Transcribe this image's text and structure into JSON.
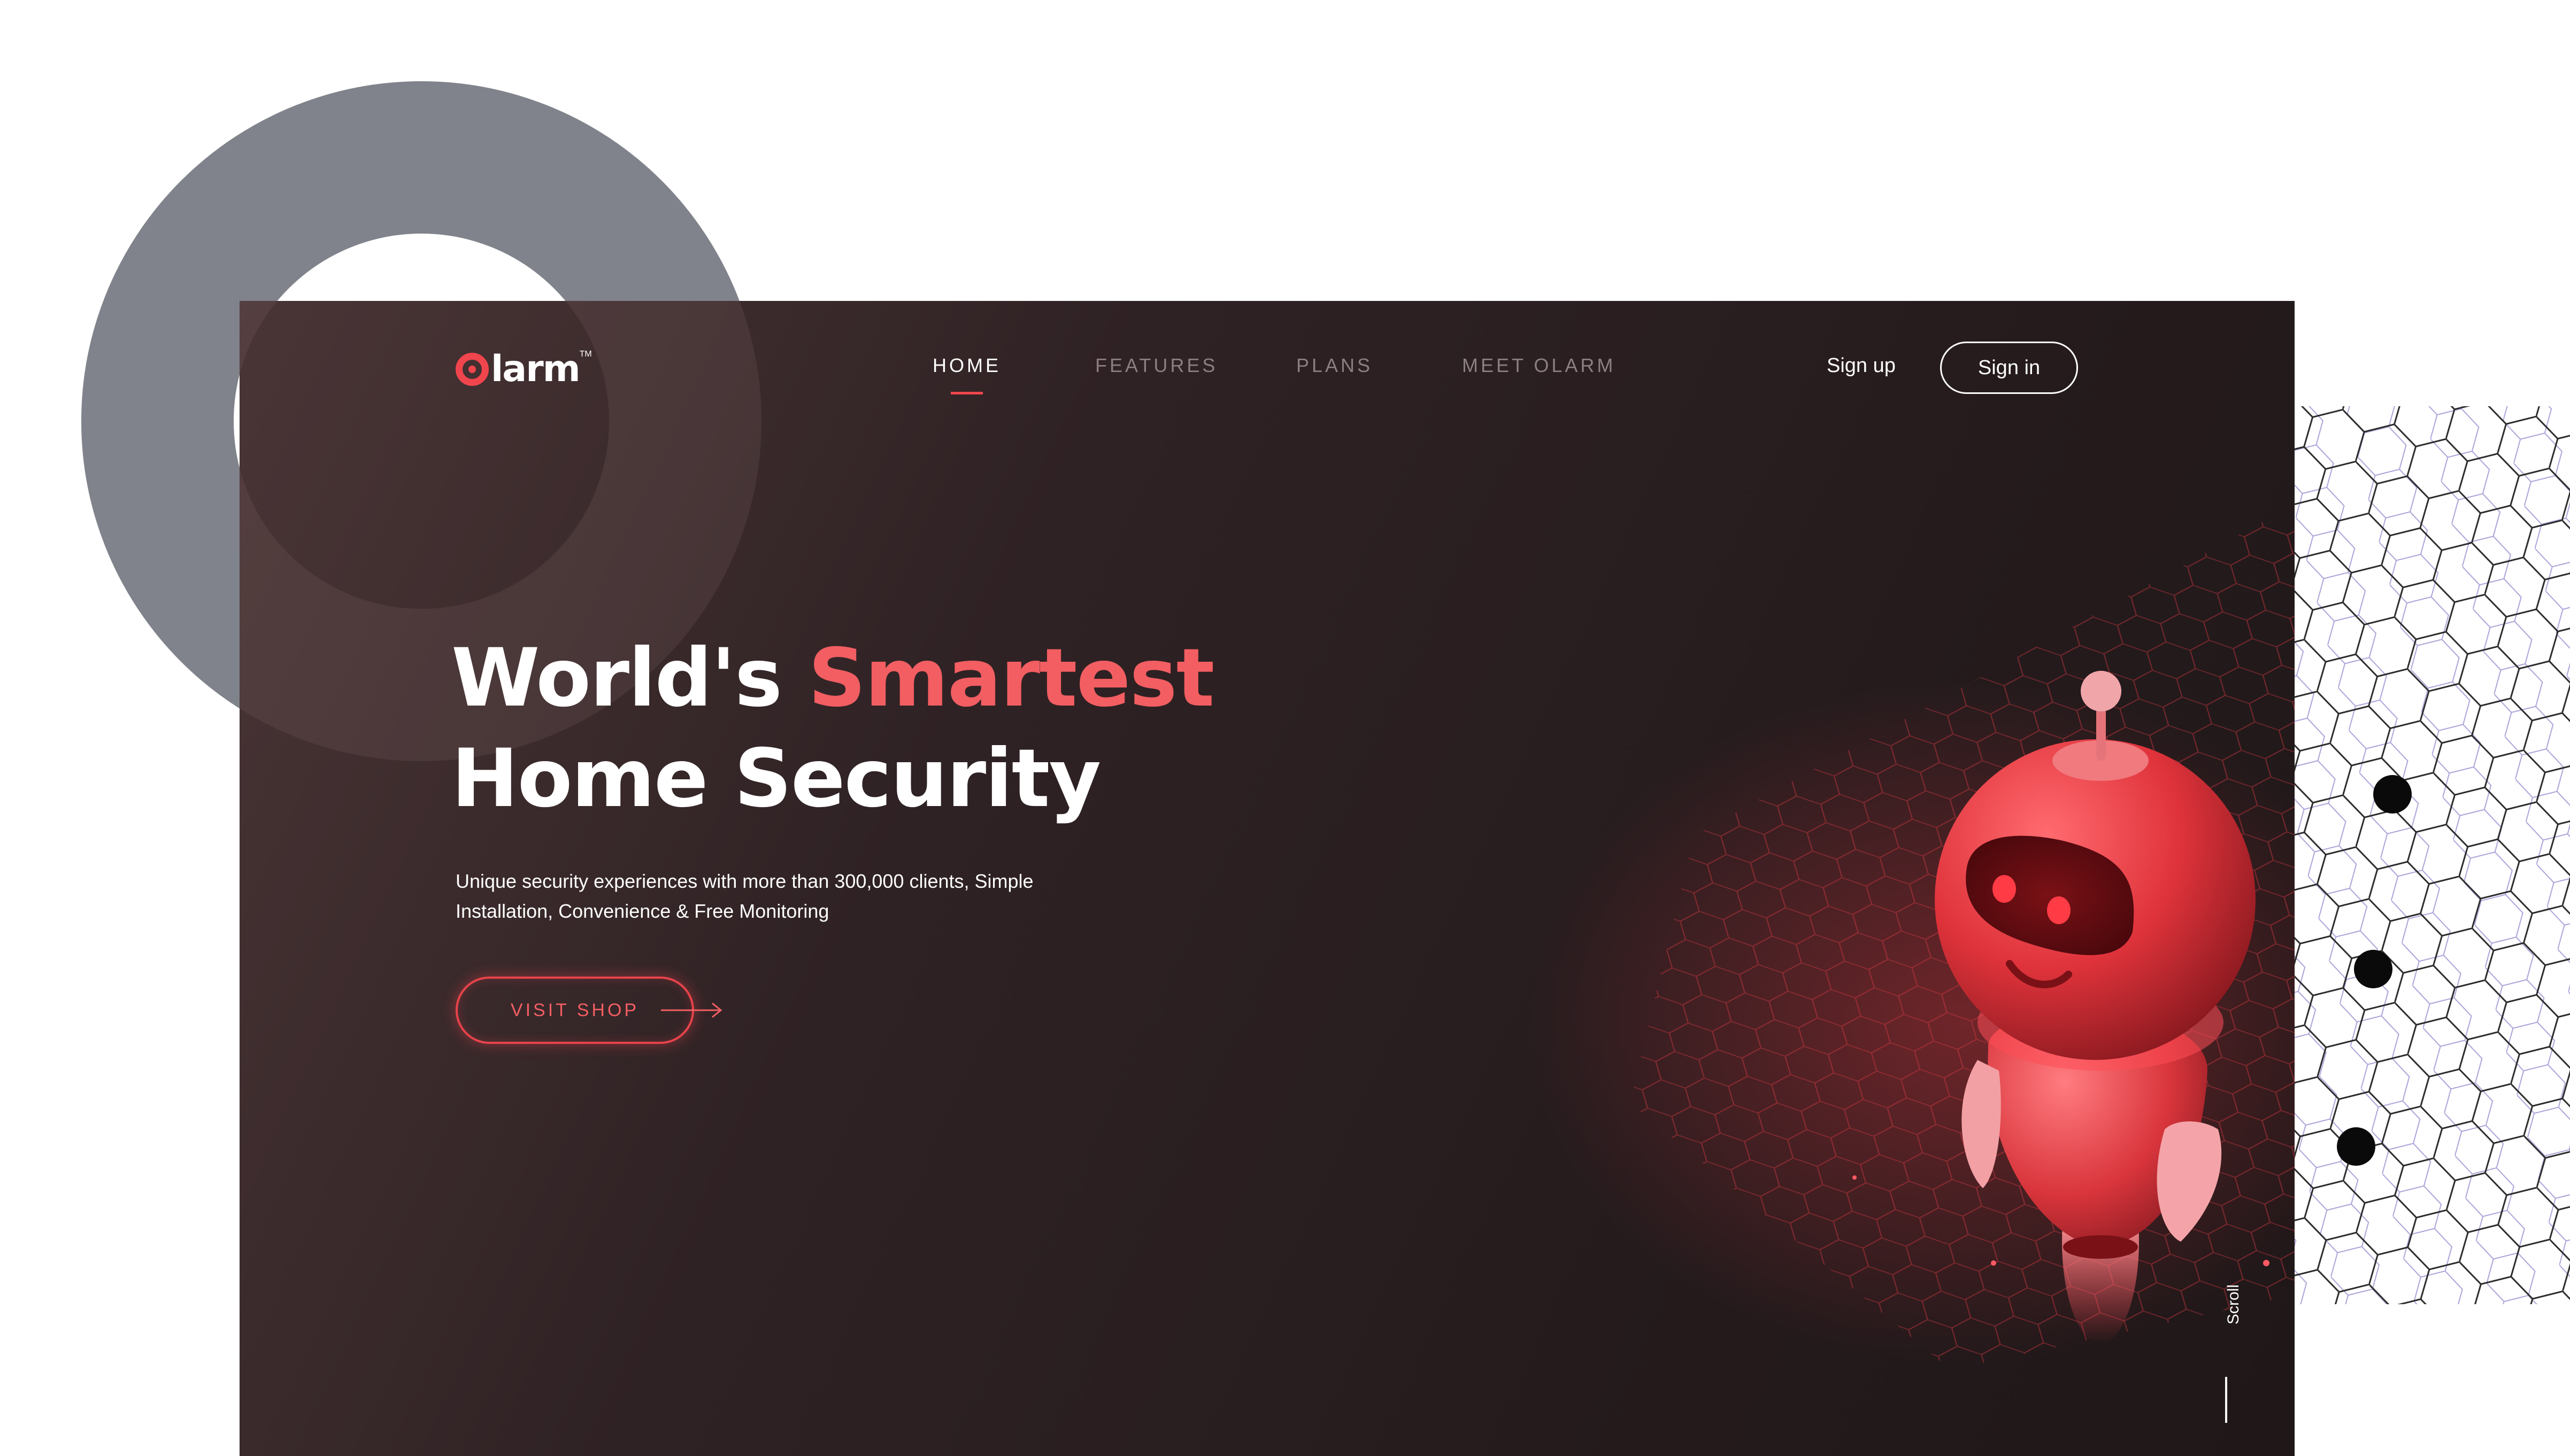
{
  "brand": {
    "logo_text": "larm",
    "trademark": "TM"
  },
  "nav": {
    "items": [
      {
        "label": "HOME",
        "active": true
      },
      {
        "label": "FEATURES",
        "active": false
      },
      {
        "label": "PLANS",
        "active": false
      },
      {
        "label": "MEET OLARM",
        "active": false
      }
    ]
  },
  "auth": {
    "signup_label": "Sign up",
    "signin_label": "Sign in"
  },
  "hero": {
    "title_line1_plain": "World's",
    "title_line1_accent": "Smartest",
    "title_line2": "Home Security",
    "subtitle_line1": "Unique security experiences with more than 300,000 clients, Simple",
    "subtitle_line2": "Installation, Convenience & Free Monitoring",
    "cta_label": "VISIT SHOP"
  },
  "scroll": {
    "label": "Scroll"
  },
  "icons": {
    "logo": "olarm-logo-icon",
    "cta_arrow": "arrow-right-icon",
    "robot": "robot-illustration"
  },
  "colors": {
    "accent": "#f25e62",
    "accent_dark": "#e8434b",
    "card_background": "#2a1f21",
    "decor_ring": "#80838b",
    "text_primary": "#ffffff",
    "nav_inactive": "#8d7f80"
  }
}
